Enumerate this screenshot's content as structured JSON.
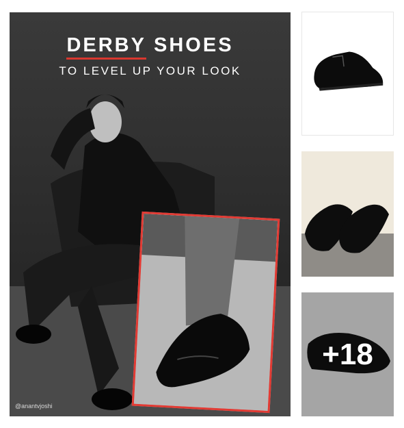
{
  "hero": {
    "title_word1": "DERBY",
    "title_word2": "SHOES",
    "subtitle": "TO LEVEL UP YOUR LOOK",
    "credit": "@anantvjoshi"
  },
  "gallery": {
    "more_count": "+18"
  },
  "colors": {
    "accent_red": "#e23a33",
    "photo_dark": "#2b2b2b"
  }
}
